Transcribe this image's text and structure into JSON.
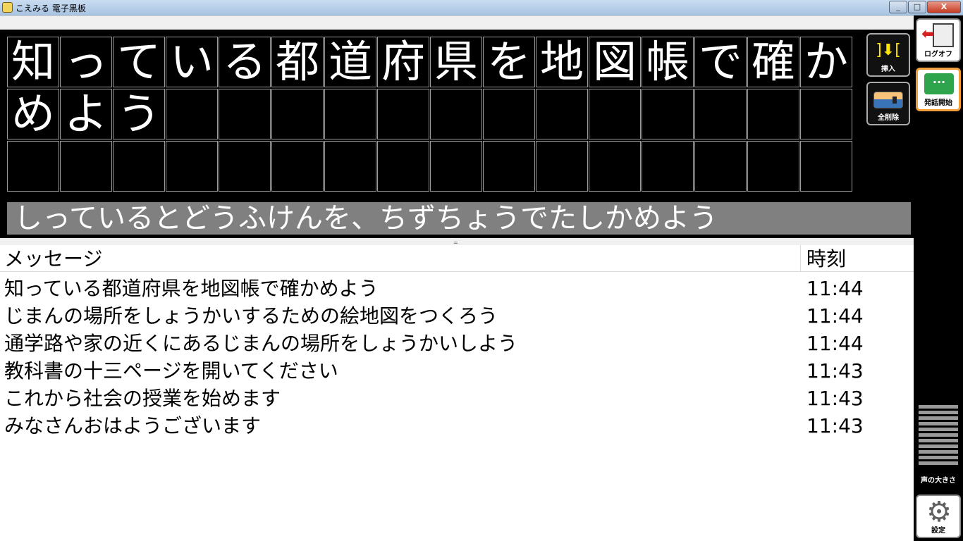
{
  "window": {
    "title": "こえみる 電子黒板",
    "minimize": "_",
    "maximize": "□",
    "close": "X"
  },
  "board": {
    "rows": [
      [
        "知",
        "っ",
        "て",
        "い",
        "る",
        "都",
        "道",
        "府",
        "県",
        "を",
        "地",
        "図",
        "帳",
        "で",
        "確",
        "か"
      ],
      [
        "め",
        "よ",
        "う",
        "",
        "",
        "",
        "",
        "",
        "",
        "",
        "",
        "",
        "",
        "",
        "",
        ""
      ],
      [
        "",
        "",
        "",
        "",
        "",
        "",
        "",
        "",
        "",
        "",
        "",
        "",
        "",
        "",
        "",
        ""
      ]
    ],
    "reading": "しっているとどうふけんを、ちずちょうでたしかめよう",
    "insert_icon": "]⬇[",
    "insert_label": "挿入",
    "clear_label": "全削除"
  },
  "list": {
    "header_message": "メッセージ",
    "header_time": "時刻",
    "rows": [
      {
        "message": "知っている都道府県を地図帳で確かめよう",
        "time": "11:44"
      },
      {
        "message": "じまんの場所をしょうかいするための絵地図をつくろう",
        "time": "11:44"
      },
      {
        "message": "通学路や家の近くにあるじまんの場所をしょうかいしよう",
        "time": "11:44"
      },
      {
        "message": "教科書の十三ページを開いてください",
        "time": "11:43"
      },
      {
        "message": "これから社会の授業を始めます",
        "time": "11:43"
      },
      {
        "message": "みなさんおはようございます",
        "time": "11:43"
      }
    ]
  },
  "sidebar": {
    "logoff_label": "ログオフ",
    "speak_label": "発話開始",
    "speak_icon": "···",
    "volume_label": "声の大きさ",
    "settings_label": "設定",
    "settings_icon": "⚙"
  },
  "colors": {
    "accent": "#f29d38",
    "speak_green": "#2ea54c",
    "reading_bg": "#808080"
  }
}
